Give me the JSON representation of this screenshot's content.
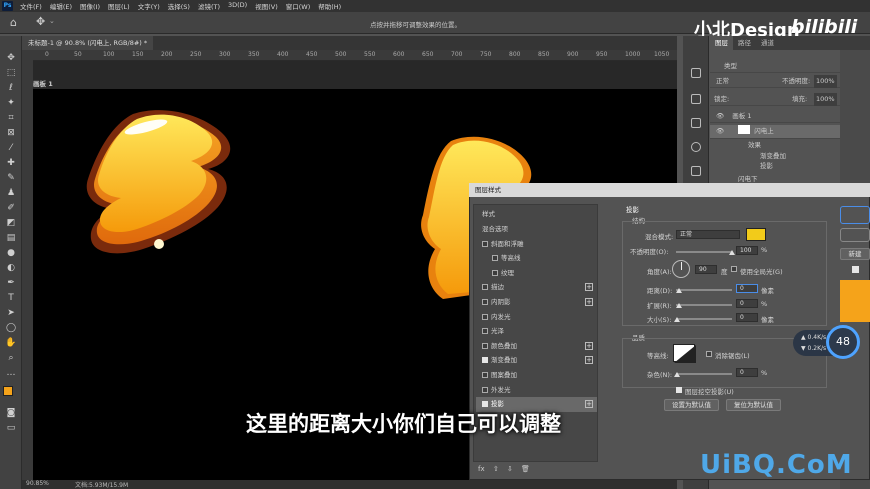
{
  "app": {
    "logo": "Ps",
    "menu": [
      "文件(F)",
      "编辑(E)",
      "图像(I)",
      "图层(L)",
      "文字(Y)",
      "选择(S)",
      "滤镜(T)",
      "3D(D)",
      "视图(V)",
      "窗口(W)",
      "帮助(H)"
    ],
    "option_hint": "点按并拖移可调整效果的位置。"
  },
  "brand": {
    "text": "小北Design",
    "logo_text": "bilibili"
  },
  "document": {
    "tab": "未标题-1 @ 90.8% (闪电上, RGB/8#) *",
    "ruler_ticks": [
      "0",
      "50",
      "100",
      "150",
      "200",
      "250",
      "300",
      "350",
      "400",
      "450",
      "500",
      "550",
      "600",
      "650",
      "700",
      "750",
      "800",
      "850",
      "900",
      "950",
      "1000",
      "1050"
    ],
    "artboard": "画板 1",
    "zoom": "90.85%",
    "docinfo": "文档:5.93M/15.9M"
  },
  "layers_panel": {
    "tabs": [
      "图层",
      "路径",
      "通道"
    ],
    "filter": "类型",
    "blend": "正常",
    "opacity_label": "不透明度:",
    "opacity": "100%",
    "lock_label": "锁定:",
    "fill_label": "填充:",
    "fill": "100%",
    "rows": [
      "画板 1",
      "闪电上",
      "效果",
      "渐变叠加",
      "投影",
      "闪电下"
    ],
    "fx": "fx"
  },
  "dialog": {
    "title": "图层样式",
    "left_header": "样式",
    "left_items": [
      {
        "label": "混合选项",
        "cb": null,
        "plus": false,
        "sel": false
      },
      {
        "label": "斜面和浮雕",
        "cb": false,
        "plus": false,
        "sel": false
      },
      {
        "label": "等高线",
        "cb": false,
        "plus": false,
        "sel": false,
        "indent": true
      },
      {
        "label": "纹理",
        "cb": false,
        "plus": false,
        "sel": false,
        "indent": true
      },
      {
        "label": "描边",
        "cb": false,
        "plus": true,
        "sel": false
      },
      {
        "label": "内阴影",
        "cb": false,
        "plus": true,
        "sel": false
      },
      {
        "label": "内发光",
        "cb": false,
        "plus": false,
        "sel": false
      },
      {
        "label": "光泽",
        "cb": false,
        "plus": false,
        "sel": false
      },
      {
        "label": "颜色叠加",
        "cb": false,
        "plus": true,
        "sel": false
      },
      {
        "label": "渐变叠加",
        "cb": true,
        "plus": true,
        "sel": false
      },
      {
        "label": "图案叠加",
        "cb": false,
        "plus": false,
        "sel": false
      },
      {
        "label": "外发光",
        "cb": false,
        "plus": false,
        "sel": false
      },
      {
        "label": "投影",
        "cb": true,
        "plus": true,
        "sel": true
      }
    ],
    "bottom_icons": "fx ⇧ ⇩ 🗑",
    "section": "投影",
    "structure": "结构",
    "blend_mode_label": "混合模式:",
    "blend_mode": "正常",
    "shadow_color": "#f2cb1a",
    "opacity_label": "不透明度(O):",
    "opacity": "100",
    "percent": "%",
    "angle_label": "角度(A):",
    "angle": "90",
    "degree": "度",
    "global_light": "使用全局光(G)",
    "distance_label": "距离(D):",
    "distance": "0",
    "size_unit": "像素",
    "spread_label": "扩展(R):",
    "spread": "0",
    "size_label": "大小(S):",
    "size": "0",
    "quality": "品质",
    "contour_label": "等高线:",
    "antialias": "消除锯齿(L)",
    "noise_label": "杂色(N):",
    "noise": "0",
    "knockout": "图层挖空投影(U)",
    "btn_default": "设置为默认值",
    "btn_reset": "复位为默认值",
    "right_btn": "新建"
  },
  "subtitle": "这里的距离大小你们自己可以调整",
  "watermark": "UiBQ.CoM",
  "perf": {
    "up": "0.4",
    "down": "0.2",
    "unit": "K/s",
    "cpu": "48"
  }
}
